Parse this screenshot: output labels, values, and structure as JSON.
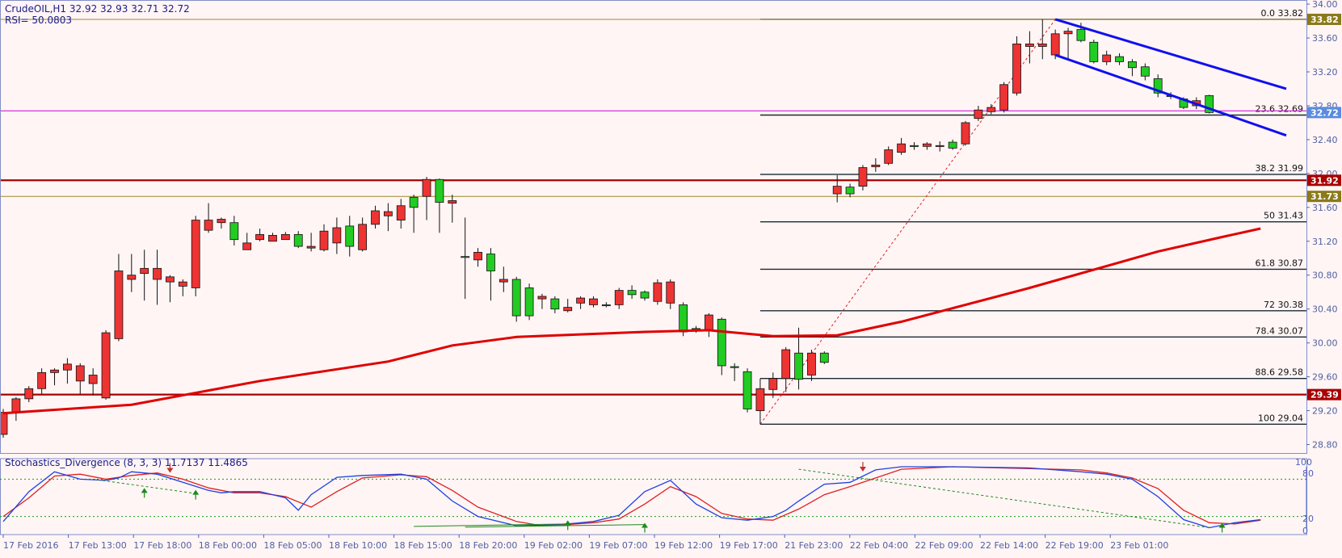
{
  "header": {
    "symbol_line": "CrudeOIL,H1  32.92 32.93 32.71 32.72",
    "rsi_line": "RSI= 50.0803"
  },
  "indicator": {
    "title": "Stochastics_Divergence (8, 3, 3) 11.7137 11.4865",
    "levels": [
      "100",
      "80",
      "20",
      "0"
    ]
  },
  "colors": {
    "background": "#FFF5F5",
    "bull": "#22CC22",
    "bear": "#EE3333",
    "ma": "#E00000",
    "channel": "#1010EE",
    "fib": "#1C2A33",
    "resistance": "#AA0000",
    "olive": "#9A8A2A",
    "magenta": "#D000D0",
    "stoch_k": "#2040E0",
    "stoch_d": "#E02020",
    "axis": "#5060C0"
  },
  "chart_data": {
    "type": "candlestick",
    "symbol": "CrudeOIL",
    "timeframe": "H1",
    "ylim": [
      28.7,
      34.02
    ],
    "y_ticks": [
      "34.00",
      "33.60",
      "33.20",
      "32.80",
      "32.40",
      "32.00",
      "31.60",
      "31.20",
      "30.80",
      "30.40",
      "30.00",
      "29.60",
      "29.20",
      "28.80"
    ],
    "x_ticks": [
      "17 Feb 2016",
      "17 Feb 13:00",
      "17 Feb 18:00",
      "18 Feb 00:00",
      "18 Feb 05:00",
      "18 Feb 10:00",
      "18 Feb 15:00",
      "18 Feb 20:00",
      "19 Feb 02:00",
      "19 Feb 07:00",
      "19 Feb 12:00",
      "19 Feb 17:00",
      "21 Feb 23:00",
      "22 Feb 04:00",
      "22 Feb 09:00",
      "22 Feb 14:00",
      "22 Feb 19:00",
      "23 Feb 01:00"
    ],
    "candles": [
      [
        29.18,
        28.92,
        29.22,
        28.88
      ],
      [
        29.34,
        29.18,
        29.36,
        29.08
      ],
      [
        29.46,
        29.34,
        29.49,
        29.3
      ],
      [
        29.65,
        29.46,
        29.7,
        29.4
      ],
      [
        29.68,
        29.65,
        29.7,
        29.5
      ],
      [
        29.75,
        29.68,
        29.82,
        29.52
      ],
      [
        29.73,
        29.55,
        29.76,
        29.4
      ],
      [
        29.62,
        29.52,
        29.7,
        29.38
      ],
      [
        30.12,
        29.35,
        30.15,
        29.33
      ],
      [
        30.85,
        30.05,
        31.05,
        30.02
      ],
      [
        30.8,
        30.75,
        31.05,
        30.6
      ],
      [
        30.88,
        30.82,
        31.1,
        30.5
      ],
      [
        30.88,
        30.75,
        31.1,
        30.45
      ],
      [
        30.78,
        30.72,
        30.8,
        30.48
      ],
      [
        30.72,
        30.67,
        30.75,
        30.55
      ],
      [
        31.45,
        30.65,
        31.5,
        30.55
      ],
      [
        31.45,
        31.33,
        31.65,
        31.3
      ],
      [
        31.46,
        31.42,
        31.48,
        31.35
      ],
      [
        31.22,
        31.42,
        31.5,
        31.15
      ],
      [
        31.18,
        31.1,
        31.3,
        31.12
      ],
      [
        31.28,
        31.22,
        31.35,
        31.2
      ],
      [
        31.27,
        31.2,
        31.3,
        31.2
      ],
      [
        31.28,
        31.22,
        31.31,
        31.22
      ],
      [
        31.14,
        31.28,
        31.32,
        31.12
      ],
      [
        31.14,
        31.12,
        31.3,
        31.08
      ],
      [
        31.32,
        31.1,
        31.4,
        31.08
      ],
      [
        31.36,
        31.18,
        31.48,
        31.05
      ],
      [
        31.14,
        31.38,
        31.5,
        31.02
      ],
      [
        31.4,
        31.1,
        31.48,
        31.08
      ],
      [
        31.56,
        31.4,
        31.62,
        31.35
      ],
      [
        31.55,
        31.5,
        31.65,
        31.32
      ],
      [
        31.62,
        31.45,
        31.7,
        31.35
      ],
      [
        31.6,
        31.72,
        31.75,
        31.3
      ],
      [
        31.93,
        31.73,
        31.96,
        31.45
      ],
      [
        31.66,
        31.93,
        31.94,
        31.3
      ],
      [
        31.68,
        31.65,
        31.75,
        31.42
      ],
      [
        31.02,
        31.02,
        31.48,
        30.52
      ],
      [
        31.07,
        30.98,
        31.12,
        30.9
      ],
      [
        30.85,
        31.05,
        31.12,
        30.5
      ],
      [
        30.75,
        30.72,
        30.9,
        30.6
      ],
      [
        30.32,
        30.75,
        30.78,
        30.25
      ],
      [
        30.32,
        30.65,
        30.7,
        30.27
      ],
      [
        30.55,
        30.52,
        30.58,
        30.4
      ],
      [
        30.4,
        30.52,
        30.55,
        30.35
      ],
      [
        30.42,
        30.38,
        30.52,
        30.36
      ],
      [
        30.53,
        30.47,
        30.55,
        30.4
      ],
      [
        30.52,
        30.45,
        30.55,
        30.42
      ],
      [
        30.45,
        30.45,
        30.48,
        30.42
      ],
      [
        30.62,
        30.45,
        30.65,
        30.4
      ],
      [
        30.57,
        30.62,
        30.68,
        30.52
      ],
      [
        30.53,
        30.6,
        30.62,
        30.5
      ],
      [
        30.71,
        30.49,
        30.75,
        30.45
      ],
      [
        30.72,
        30.47,
        30.75,
        30.4
      ],
      [
        30.13,
        30.45,
        30.48,
        30.08
      ],
      [
        30.16,
        30.17,
        30.2,
        30.12
      ],
      [
        30.33,
        30.15,
        30.35,
        30.07
      ],
      [
        29.73,
        30.28,
        30.3,
        29.62
      ],
      [
        29.71,
        29.72,
        29.76,
        29.55
      ],
      [
        29.22,
        29.66,
        29.7,
        29.18
      ],
      [
        29.46,
        29.2,
        29.58,
        29.04
      ],
      [
        29.58,
        29.45,
        29.65,
        29.35
      ],
      [
        29.92,
        29.58,
        29.95,
        29.42
      ],
      [
        29.57,
        29.88,
        30.18,
        29.45
      ],
      [
        29.88,
        29.62,
        29.92,
        29.55
      ],
      [
        29.77,
        29.88,
        29.9,
        29.75
      ],
      [
        31.85,
        31.76,
        31.98,
        31.66
      ],
      [
        31.76,
        31.84,
        31.88,
        31.72
      ],
      [
        32.07,
        31.85,
        32.1,
        31.8
      ],
      [
        32.1,
        32.08,
        32.18,
        32.02
      ],
      [
        32.28,
        32.12,
        32.32,
        32.1
      ],
      [
        32.35,
        32.25,
        32.42,
        32.22
      ],
      [
        32.32,
        32.33,
        32.37,
        32.28
      ],
      [
        32.35,
        32.32,
        32.37,
        32.28
      ],
      [
        32.33,
        32.32,
        32.38,
        32.26
      ],
      [
        32.3,
        32.37,
        32.4,
        32.28
      ],
      [
        32.6,
        32.35,
        32.62,
        32.33
      ],
      [
        32.75,
        32.65,
        32.8,
        32.62
      ],
      [
        32.78,
        32.73,
        32.82,
        32.7
      ],
      [
        33.05,
        32.75,
        33.08,
        32.72
      ],
      [
        33.53,
        32.95,
        33.62,
        32.92
      ],
      [
        33.53,
        33.5,
        33.68,
        33.3
      ],
      [
        33.53,
        33.5,
        33.82,
        33.35
      ],
      [
        33.65,
        33.4,
        33.7,
        33.35
      ],
      [
        33.68,
        33.65,
        33.72,
        33.35
      ],
      [
        33.57,
        33.7,
        33.78,
        33.55
      ],
      [
        33.32,
        33.55,
        33.58,
        33.3
      ],
      [
        33.4,
        33.32,
        33.45,
        33.28
      ],
      [
        33.32,
        33.38,
        33.42,
        33.28
      ],
      [
        33.25,
        33.32,
        33.35,
        33.15
      ],
      [
        33.15,
        33.26,
        33.3,
        33.1
      ],
      [
        32.95,
        33.12,
        33.17,
        32.9
      ],
      [
        32.92,
        32.92,
        32.96,
        32.88
      ],
      [
        32.78,
        32.88,
        32.9,
        32.76
      ],
      [
        32.86,
        32.8,
        32.9,
        32.76
      ],
      [
        32.72,
        32.92,
        32.93,
        32.71
      ]
    ],
    "ma_line": [
      [
        0,
        29.17
      ],
      [
        10,
        29.27
      ],
      [
        20,
        29.55
      ],
      [
        30,
        29.78
      ],
      [
        35,
        29.97
      ],
      [
        40,
        30.07
      ],
      [
        50,
        30.13
      ],
      [
        55,
        30.15
      ],
      [
        60,
        30.08
      ],
      [
        65,
        30.09
      ],
      [
        70,
        30.25
      ],
      [
        80,
        30.65
      ],
      [
        90,
        31.08
      ],
      [
        95,
        31.25
      ],
      [
        98,
        31.35
      ]
    ],
    "fib_levels": [
      {
        "ratio": "0.0",
        "value": 33.82
      },
      {
        "ratio": "23.6",
        "value": 32.69
      },
      {
        "ratio": "38.2",
        "value": 31.99
      },
      {
        "ratio": "50",
        "value": 31.43
      },
      {
        "ratio": "61.8",
        "value": 30.87
      },
      {
        "ratio": "72",
        "value": 30.38
      },
      {
        "ratio": "78.4",
        "value": 30.07
      },
      {
        "ratio": "88.6",
        "value": 29.58
      },
      {
        "ratio": "100",
        "value": 29.04
      }
    ],
    "fib_start_index": 59,
    "fib_labels": [
      "0.0  33.82",
      "23.6  32.69",
      "38.2  31.99",
      "50  31.43",
      "61.8  30.87",
      "72  30.38",
      "78.4  30.07",
      "88.6  29.58",
      "100  29.04"
    ],
    "fib_trendline": {
      "from": [
        59,
        29.04
      ],
      "to": [
        82,
        33.82
      ]
    },
    "horizontal_lines": [
      {
        "value": 33.82,
        "kind": "olive",
        "label": "33.82"
      },
      {
        "value": 32.74,
        "kind": "magenta",
        "label": "32.72"
      },
      {
        "value": 31.92,
        "kind": "resistance",
        "label": "31.92"
      },
      {
        "value": 31.73,
        "kind": "olive",
        "label": "31.73"
      },
      {
        "value": 29.39,
        "kind": "resistance",
        "label": "29.39"
      }
    ],
    "price_tags": [
      {
        "value": 33.82,
        "label": "33.82",
        "bg": "#8A7A1A",
        "fg": "#FFFFFF"
      },
      {
        "value": 32.72,
        "label": "32.72",
        "bg": "#5A8CE0",
        "fg": "#FFFFFF"
      },
      {
        "value": 31.92,
        "label": "31.92",
        "bg": "#AA0000",
        "fg": "#FFFFFF"
      },
      {
        "value": 31.73,
        "label": "31.73",
        "bg": "#8A7A1A",
        "fg": "#FFFFFF"
      },
      {
        "value": 29.39,
        "label": "29.39",
        "bg": "#AA0000",
        "fg": "#FFFFFF"
      }
    ],
    "channel": [
      {
        "from": [
          82,
          33.82
        ],
        "to": [
          100,
          33.0
        ]
      },
      {
        "from": [
          82,
          33.4
        ],
        "to": [
          100,
          32.45
        ]
      }
    ],
    "stochastic": {
      "ylim": [
        0,
        100
      ],
      "k": [
        [
          0,
          12
        ],
        [
          2,
          60
        ],
        [
          4,
          92
        ],
        [
          6,
          80
        ],
        [
          8,
          78
        ],
        [
          9,
          82
        ],
        [
          10,
          92
        ],
        [
          12,
          88
        ],
        [
          14,
          75
        ],
        [
          16,
          62
        ],
        [
          17,
          58
        ],
        [
          18,
          60
        ],
        [
          20,
          60
        ],
        [
          22,
          50
        ],
        [
          23,
          30
        ],
        [
          24,
          55
        ],
        [
          26,
          83
        ],
        [
          28,
          86
        ],
        [
          31,
          88
        ],
        [
          33,
          80
        ],
        [
          35,
          45
        ],
        [
          37,
          20
        ],
        [
          40,
          5
        ],
        [
          42,
          6
        ],
        [
          44,
          8
        ],
        [
          46,
          12
        ],
        [
          48,
          22
        ],
        [
          50,
          60
        ],
        [
          52,
          78
        ],
        [
          54,
          40
        ],
        [
          56,
          18
        ],
        [
          58,
          14
        ],
        [
          60,
          20
        ],
        [
          61,
          30
        ],
        [
          62,
          45
        ],
        [
          64,
          72
        ],
        [
          66,
          75
        ],
        [
          68,
          95
        ],
        [
          70,
          100
        ],
        [
          74,
          100
        ],
        [
          80,
          98
        ],
        [
          84,
          92
        ],
        [
          86,
          88
        ],
        [
          88,
          80
        ],
        [
          90,
          52
        ],
        [
          92,
          15
        ],
        [
          94,
          2
        ],
        [
          96,
          10
        ],
        [
          98,
          15
        ]
      ],
      "d": [
        [
          0,
          20
        ],
        [
          2,
          50
        ],
        [
          4,
          85
        ],
        [
          6,
          88
        ],
        [
          8,
          80
        ],
        [
          10,
          86
        ],
        [
          12,
          90
        ],
        [
          14,
          80
        ],
        [
          16,
          66
        ],
        [
          18,
          58
        ],
        [
          20,
          58
        ],
        [
          22,
          52
        ],
        [
          24,
          35
        ],
        [
          26,
          60
        ],
        [
          28,
          82
        ],
        [
          31,
          87
        ],
        [
          33,
          84
        ],
        [
          35,
          62
        ],
        [
          37,
          35
        ],
        [
          40,
          12
        ],
        [
          42,
          5
        ],
        [
          44,
          7
        ],
        [
          46,
          10
        ],
        [
          48,
          16
        ],
        [
          50,
          40
        ],
        [
          52,
          68
        ],
        [
          54,
          52
        ],
        [
          56,
          25
        ],
        [
          58,
          16
        ],
        [
          60,
          14
        ],
        [
          62,
          32
        ],
        [
          64,
          55
        ],
        [
          66,
          68
        ],
        [
          68,
          82
        ],
        [
          70,
          96
        ],
        [
          74,
          100
        ],
        [
          80,
          97
        ],
        [
          84,
          95
        ],
        [
          86,
          90
        ],
        [
          88,
          82
        ],
        [
          90,
          65
        ],
        [
          92,
          30
        ],
        [
          94,
          10
        ],
        [
          96,
          8
        ],
        [
          98,
          14
        ]
      ],
      "div_lines": [
        {
          "from": [
            7,
            80
          ],
          "to": [
            15,
            57
          ],
          "color": "#1A8A1A",
          "dash": true
        },
        {
          "from": [
            32,
            4
          ],
          "to": [
            44,
            8
          ],
          "color": "#1A8A1A",
          "dash": false
        },
        {
          "from": [
            36,
            3
          ],
          "to": [
            50,
            7
          ],
          "color": "#1A8A1A",
          "dash": false
        },
        {
          "from": [
            62,
            96
          ],
          "to": [
            94,
            2
          ],
          "color": "#1A8A1A",
          "dash": true
        }
      ],
      "arrows": [
        {
          "i": 11,
          "v": 58,
          "dir": "up",
          "color": "#1A8A1A"
        },
        {
          "i": 15,
          "v": 55,
          "dir": "up",
          "color": "#1A8A1A"
        },
        {
          "i": 13,
          "v": 98,
          "dir": "down",
          "color": "#C03030"
        },
        {
          "i": 44,
          "v": 6,
          "dir": "up",
          "color": "#1A8A1A"
        },
        {
          "i": 50,
          "v": 2,
          "dir": "up",
          "color": "#1A8A1A"
        },
        {
          "i": 67,
          "v": 100,
          "dir": "down",
          "color": "#C03030"
        },
        {
          "i": 95,
          "v": 2,
          "dir": "up",
          "color": "#1A8A1A"
        }
      ]
    }
  }
}
